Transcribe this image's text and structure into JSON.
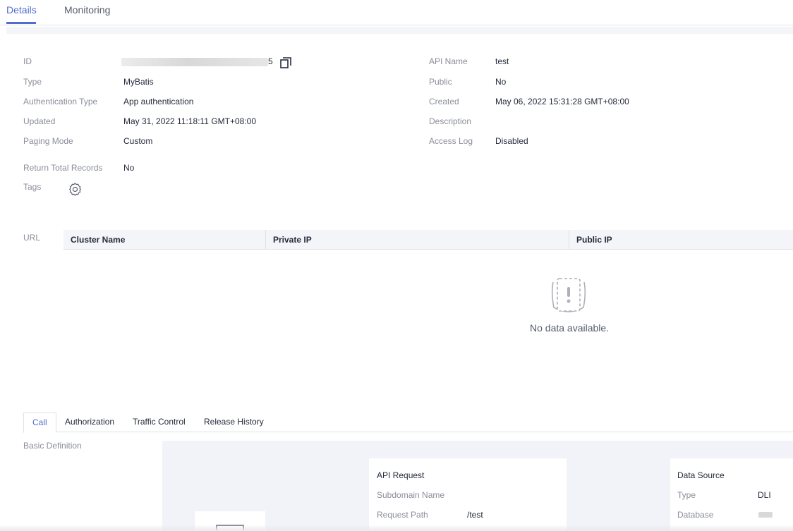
{
  "top_tabs": [
    "Details",
    "Monitoring"
  ],
  "details": {
    "id_suffix": "5",
    "labels": {
      "id": "ID",
      "type": "Type",
      "auth_type": "Authentication Type",
      "updated": "Updated",
      "paging_mode": "Paging Mode",
      "return_total": "Return Total Records",
      "tags": "Tags",
      "api_name": "API Name",
      "public": "Public",
      "created": "Created",
      "description": "Description",
      "access_log": "Access Log"
    },
    "values": {
      "type": "MyBatis",
      "auth_type": "App authentication",
      "updated": "May 31, 2022 11:18:11 GMT+08:00",
      "paging_mode": "Custom",
      "return_total": "No",
      "api_name": "test",
      "public": "No",
      "created": "May 06, 2022 15:31:28 GMT+08:00",
      "description": "",
      "access_log": "Disabled"
    }
  },
  "url_section": {
    "label": "URL",
    "columns": [
      "Cluster Name",
      "Private IP",
      "Public IP"
    ],
    "empty_text": "No data available."
  },
  "sub_tabs": [
    "Call",
    "Authorization",
    "Traffic Control",
    "Release History"
  ],
  "basic_definition": "Basic Definition",
  "api_request": {
    "title": "API Request",
    "subdomain_label": "Subdomain Name",
    "subdomain_value": "",
    "path_label": "Request Path",
    "path_value": "/test"
  },
  "data_source": {
    "title": "Data Source",
    "type_label": "Type",
    "type_value": "DLI",
    "database_label": "Database"
  },
  "colors": {
    "accent": "#526ecc",
    "label": "#8a8e99",
    "text": "#252b3a",
    "canvas_bg": "#f1f3f8"
  }
}
